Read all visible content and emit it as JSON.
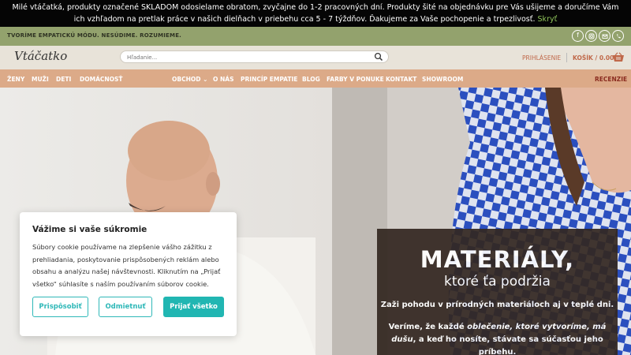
{
  "notice": {
    "text": "Milé vtáčatká, produkty označené SKLADOM odosielame obratom, zvyčajne do 1-2 pracovných dní. Produkty šité na objednávku pre Vás ušijeme a doručíme Vám ich vzhľadom na pretlak práce v našich dielňach v priebehu cca 5 - 7 týždňov. Ďakujeme za Vaše pochopenie a trpezlivosť.",
    "hide_link": "Skryť"
  },
  "topbar": {
    "tagline": "TVORÍME EMPATICKÚ MÓDU. NESÚDIME. ROZUMIEME.",
    "social_icons": [
      "facebook-icon",
      "instagram-icon",
      "email-icon",
      "phone-icon"
    ]
  },
  "header": {
    "logo_text": "Vtáčatko",
    "search_placeholder": "Hľadanie...",
    "login_label": "PRIHLÁSENIE",
    "cart_label": "KOŠÍK",
    "cart_amount": "0.00€"
  },
  "nav": {
    "items": [
      "ŽENY",
      "MUŽI",
      "DETI",
      "DOMÁCNOSŤ",
      "OBCHOD",
      "O NÁS",
      "PRINCÍP EMPATIE",
      "BLOG",
      "FARBY V PONUKE",
      "KONTAKT",
      "SHOWROOM"
    ],
    "reviews": "RECENZIE"
  },
  "hero": {
    "headline": "MATERIÁLY,",
    "subheadline": "ktoré ťa podržia",
    "line1": "Zaži pohodu v prírodných materiáloch aj v teplé dni.",
    "line2_a": "Veríme, že každé ",
    "line2_b": "oblečenie, ktoré vytvoríme, má dušu",
    "line2_c": ", a keď ho nosíte, stávate sa súčasťou jeho príbehu."
  },
  "cookie": {
    "title": "Vážime si vaše súkromie",
    "text": "Súbory cookie používame na zlepšenie vášho zážitku z prehliadania, poskytovanie prispôsobených reklám alebo obsahu a analýzu našej návštevnosti. Kliknutím na „Prijať všetko“ súhlasíte s naším používaním súborov cookie.",
    "customize": "Prispôsobiť",
    "reject": "Odmietnuť",
    "accept": "Prijať všetko"
  },
  "colors": {
    "notice_bg": "#050505",
    "topbar_bg": "#93a26d",
    "header_bg": "#e8e3d9",
    "nav_bg": "#dcaa88",
    "accent": "#c0694a",
    "cookie_accent": "#21b6b2"
  }
}
